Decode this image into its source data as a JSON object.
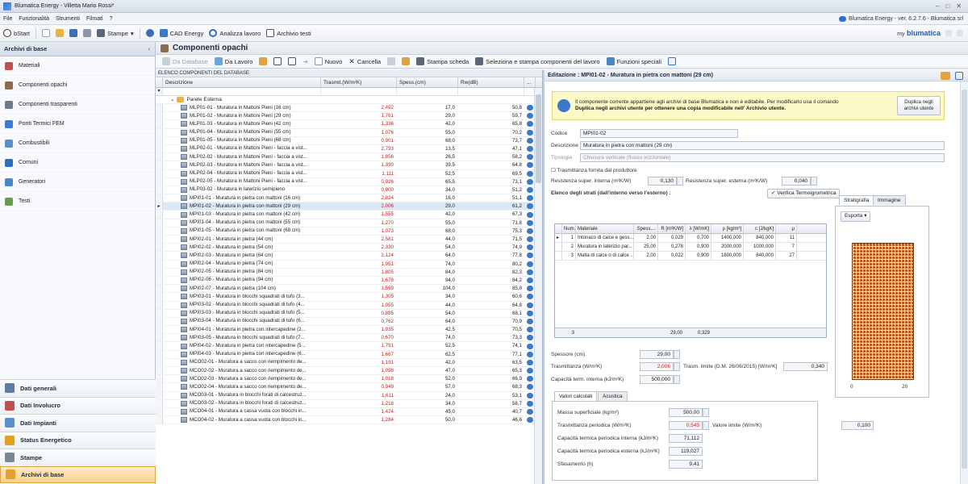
{
  "window": {
    "title": "Blumatica Energy - Villetta Mario Rossi*",
    "version": "Blumatica Energy - ver. 6.2.7.6 - Blumatica srl"
  },
  "menu": [
    "File",
    "Funzionalità",
    "Strumenti",
    "Filmati",
    "?"
  ],
  "toolbar": {
    "start": "bStart",
    "stampe": "Stampe",
    "cad": "CAD Energy",
    "analizza": "Analizza lavoro",
    "archivio": "Archivio testi",
    "brand_my": "my",
    "brand": "blumatica"
  },
  "sidebar": {
    "title": "Archivi di base",
    "items": [
      {
        "label": "Materiali",
        "icon": "materials-icon",
        "color": "#c0504d"
      },
      {
        "label": "Componenti opachi",
        "icon": "opaque-components-icon",
        "color": "#8c6b4a"
      },
      {
        "label": "Componenti trasparenti",
        "icon": "transparent-components-icon",
        "color": "#6c7a8a"
      },
      {
        "label": "Ponti Termici FEM",
        "icon": "thermal-bridge-icon",
        "color": "#3d7bd0"
      },
      {
        "label": "Combustibili",
        "icon": "fuel-icon",
        "color": "#5b8fc8"
      },
      {
        "label": "Comuni",
        "icon": "municipality-icon",
        "color": "#2f6fb8"
      },
      {
        "label": "Generatori",
        "icon": "generator-icon",
        "color": "#4a86c5"
      },
      {
        "label": "Testi",
        "icon": "text-icon",
        "color": "#6a9c4a"
      }
    ],
    "bottom": [
      {
        "label": "Dati generali",
        "icon": "general-data-icon",
        "color": "#5d7da6"
      },
      {
        "label": "Dati Involucro",
        "icon": "envelope-data-icon",
        "color": "#c0504d"
      },
      {
        "label": "Dati Impianti",
        "icon": "plant-data-icon",
        "color": "#5a8fc8"
      },
      {
        "label": "Status Energetico",
        "icon": "energy-status-icon",
        "color": "#e0a020"
      },
      {
        "label": "Stampe",
        "icon": "print-icon",
        "color": "#7a8696"
      },
      {
        "label": "Archivi di base",
        "icon": "base-archive-icon",
        "color": "#e8a030"
      }
    ]
  },
  "main": {
    "title": "Componenti opachi",
    "tools": [
      "Da Database",
      "Da Lavoro",
      "Nuovo",
      "Cancella",
      "Stampa scheda",
      "Seleziona e stampa componenti del lavoro",
      "Funzioni speciali"
    ]
  },
  "grid": {
    "label": "ELENCO COMPONENTI DEL DATABASE",
    "headers": [
      "Descrizione",
      "Trasmit.(W/m²K)",
      "Spess.(cm)",
      "Rw(dB)",
      "..."
    ],
    "group": "Parete Esterna",
    "rows": [
      [
        "MLP01-01 - Muratura in Mattoni Pieni (16 cm)",
        "2,492",
        "17,0",
        "50,8"
      ],
      [
        "MLP01-02 - Muratura in Mattoni Pieni (29 cm)",
        "1,761",
        "29,0",
        "59,7"
      ],
      [
        "MLP01-03 - Muratura in Mattoni Pieni (42 cm)",
        "1,336",
        "42,0",
        "65,8"
      ],
      [
        "MLP01-04 - Muratura in Mattoni Pieni (55 cm)",
        "1,076",
        "55,0",
        "70,2"
      ],
      [
        "MLP01-05 - Muratura in Mattoni Pieni (68 cm)",
        "0,901",
        "68,0",
        "73,7"
      ],
      [
        "MLP02-01 - Muratura in Mattoni Pieni - faccia a vist...",
        "2,793",
        "13,5",
        "47,1"
      ],
      [
        "MLP02-02 - Muratura in Mattoni Pieni - faccia a vist...",
        "1,856",
        "26,5",
        "58,2"
      ],
      [
        "MLP02-03 - Muratura in Mattoni Pieni - faccia a vist...",
        "1,390",
        "39,5",
        "64,8"
      ],
      [
        "MLP02-04 - Muratura in Mattoni Pieni - faccia a vist...",
        "1,111",
        "52,5",
        "69,5"
      ],
      [
        "MLP02-05 - Muratura in Mattoni Pieni - faccia a vist...",
        "0,926",
        "65,5",
        "73,1"
      ],
      [
        "MLP03-02 - Muratura in laterizio semipieno",
        "0,900",
        "34,0",
        "51,2"
      ],
      [
        "MPI01-01 - Muratura in pietra con mattoni  (16 cm)",
        "2,824",
        "16,0",
        "51,1"
      ],
      [
        "MPI01-02 - Muratura in pietra con mattoni (29 cm)",
        "2,006",
        "29,0",
        "61,2"
      ],
      [
        "MPI01-03 - Muratura in pietra con mattoni (42 cm)",
        "1,555",
        "42,0",
        "67,3"
      ],
      [
        "MPI01-04 - Muratura in pietra con mattoni (55 cm)",
        "1,270",
        "55,0",
        "71,8"
      ],
      [
        "MPI01-05 - Muratura in pietra con mattoni (68 cm)",
        "1,073",
        "68,0",
        "75,3"
      ],
      [
        "MPI02-01 - Muratura in pietra (44 cm)",
        "2,581",
        "44,0",
        "71,5"
      ],
      [
        "MPI02-02 - Muratura in pietra (54 cm)",
        "2,330",
        "54,0",
        "74,9"
      ],
      [
        "MPI02-03 - Muratura in pietra (64 cm)",
        "2,124",
        "64,0",
        "77,8"
      ],
      [
        "MPI02-04 - Muratura in pietra (74 cm)",
        "1,951",
        "74,0",
        "80,2"
      ],
      [
        "MPI02-05 - Muratura in pietra (84 cm)",
        "1,805",
        "84,0",
        "82,3"
      ],
      [
        "MPI02-06 - Muratura in pietra (94 cm)",
        "1,678",
        "94,0",
        "84,2"
      ],
      [
        "MPI02-07 - Muratura in pietra (104 cm)",
        "1,569",
        "104,0",
        "85,8"
      ],
      [
        "MPI03-01 - Muratura in blocchi squadrati di tufo (3...",
        "1,305",
        "34,0",
        "60,6"
      ],
      [
        "MPI03-02 - Muratura in blocchi squadrati di tufo (4...",
        "1,055",
        "44,0",
        "64,8"
      ],
      [
        "MPI03-03 - Muratura in blocchi squadrati di tufo (5...",
        "0,885",
        "54,0",
        "68,1"
      ],
      [
        "MPI03-04 - Muratura in blocchi squadrati di tufo (6...",
        "0,762",
        "64,0",
        "70,9"
      ],
      [
        "MPI04-01 - Muratura in pietra con intercapedine (2...",
        "1,935",
        "42,5",
        "70,5"
      ],
      [
        "MPI03-05 - Muratura in blocchi squadrati di tufo (7...",
        "0,670",
        "74,0",
        "73,3"
      ],
      [
        "MPI04-02 - Muratura in pietra con intercapedine (5...",
        "1,791",
        "52,5",
        "74,1"
      ],
      [
        "MPI04-03 - Muratura in pietra con intercapedine (6...",
        "1,667",
        "62,5",
        "77,1"
      ],
      [
        "MCO02-01 - Muratura a sacco con riempimento de...",
        "1,191",
        "42,0",
        "63,5"
      ],
      [
        "MCO02-02 - Muratura a sacco con riempimento de...",
        "1,098",
        "47,0",
        "65,3"
      ],
      [
        "MCO02-03 - Muratura a sacco con riempimento de...",
        "1,018",
        "52,0",
        "66,9"
      ],
      [
        "MCO02-04 - Muratura a sacco con riempimento de...",
        "0,949",
        "57,0",
        "68,3"
      ],
      [
        "MCO03-01 - Muratura in blocchi forati di calcestruz...",
        "1,611",
        "24,0",
        "53,1"
      ],
      [
        "MCO03-02 - Muratura in blocchi forati di calcestruz...",
        "1,218",
        "34,0",
        "58,7"
      ],
      [
        "MCO04-01 - Muratura a cassa vuota con blocchi in...",
        "1,474",
        "45,0",
        "40,7"
      ],
      [
        "MCO04-02 - Muratura a cassa vuota con blocchi in...",
        "1,284",
        "50,0",
        "46,6"
      ]
    ]
  },
  "editor": {
    "title": "Editazione : MPI01-02 - Muratura in pietra con mattoni (29 cm)",
    "info_line1": "Il componente corrente appartiene agli archivi di base Blumatica e non è editabile. Per modificarlo usa il comando",
    "info_line2": "Duplica negli archivi utente per ottenere una copia modificabile nell' Archivio utente.",
    "dup_button": "Duplica negli archivi utente",
    "codice_label": "Codice",
    "codice": "MPI01-02",
    "descr_label": "Descrizione",
    "descr": "Muratura in pietra con mattoni (29 cm)",
    "tipologia_label": "Tipologia",
    "tipologia": "Chiusura verticale (flusso orizzontale)",
    "tras_prod": "Trasmittanza fornita dal produttore",
    "rsi_label": "Resistenza super. interna (m²K/W)",
    "rsi": "0,130",
    "rse_label": "Resistenza super. esterna (m²K/W)",
    "rse": "0,040",
    "strati_title": "Elenco degli strati  (dall'interno verso l'esterno) :",
    "verify": "Verifica Termoigrometrica",
    "tab_strat": "Stratigrafia",
    "tab_img": "Immagine",
    "export": "Esporta",
    "strati_headers": [
      "Num.",
      "Materiale",
      "Spess....",
      "R [m²K/W]",
      "λ [W/mK]",
      "ρ [kg/m³]",
      "c [J/kgK]",
      "μ"
    ],
    "strati": [
      [
        "1",
        "Intonaco di calce e gess...",
        "2,00",
        "0,029",
        "0,700",
        "1400,000",
        "840,000",
        "11"
      ],
      [
        "2",
        "Muratura in laterizio par...",
        "25,00",
        "0,278",
        "0,900",
        "2000,000",
        "1000,000",
        "7"
      ],
      [
        "3",
        "Malta di calce o di calce ...",
        "2,00",
        "0,022",
        "0,900",
        "1800,000",
        "840,000",
        "27"
      ]
    ],
    "strati_count": "3",
    "strati_spess": "29,00",
    "strati_r": "0,329",
    "spess_label": "Spessore (cm)",
    "spess": "29,00",
    "tras_label": "Trasmittanza (W/m²K)",
    "tras": "2,006",
    "limite_label": "Trasm. limite (D.M. 26/06/2015) [W/m²K]",
    "limite": "0,340",
    "cap_label": "Capacità term. interna (kJ/m²K)",
    "cap": "500,000",
    "axis0": "0",
    "axis20": "20",
    "tab_calc": "Valori calcolati",
    "tab_acu": "Acustica",
    "massa_label": "Massa superficiale (kg/m²)",
    "massa": "500,00",
    "trasper_label": "Trasmittanza periodica (W/m²K)",
    "trasper": "0,545",
    "vlim_label": "Valore limite (W/m²K)",
    "vlim": "0,100",
    "capint_label": "Capacità termica periodica interna (kJ/m²K)",
    "capint": "71,112",
    "capest_label": "Capacità termica periodica esterna (kJ/m²K)",
    "capest": "119,027",
    "sfas_label": "Sfasamento (h)",
    "sfas": "9,41"
  }
}
